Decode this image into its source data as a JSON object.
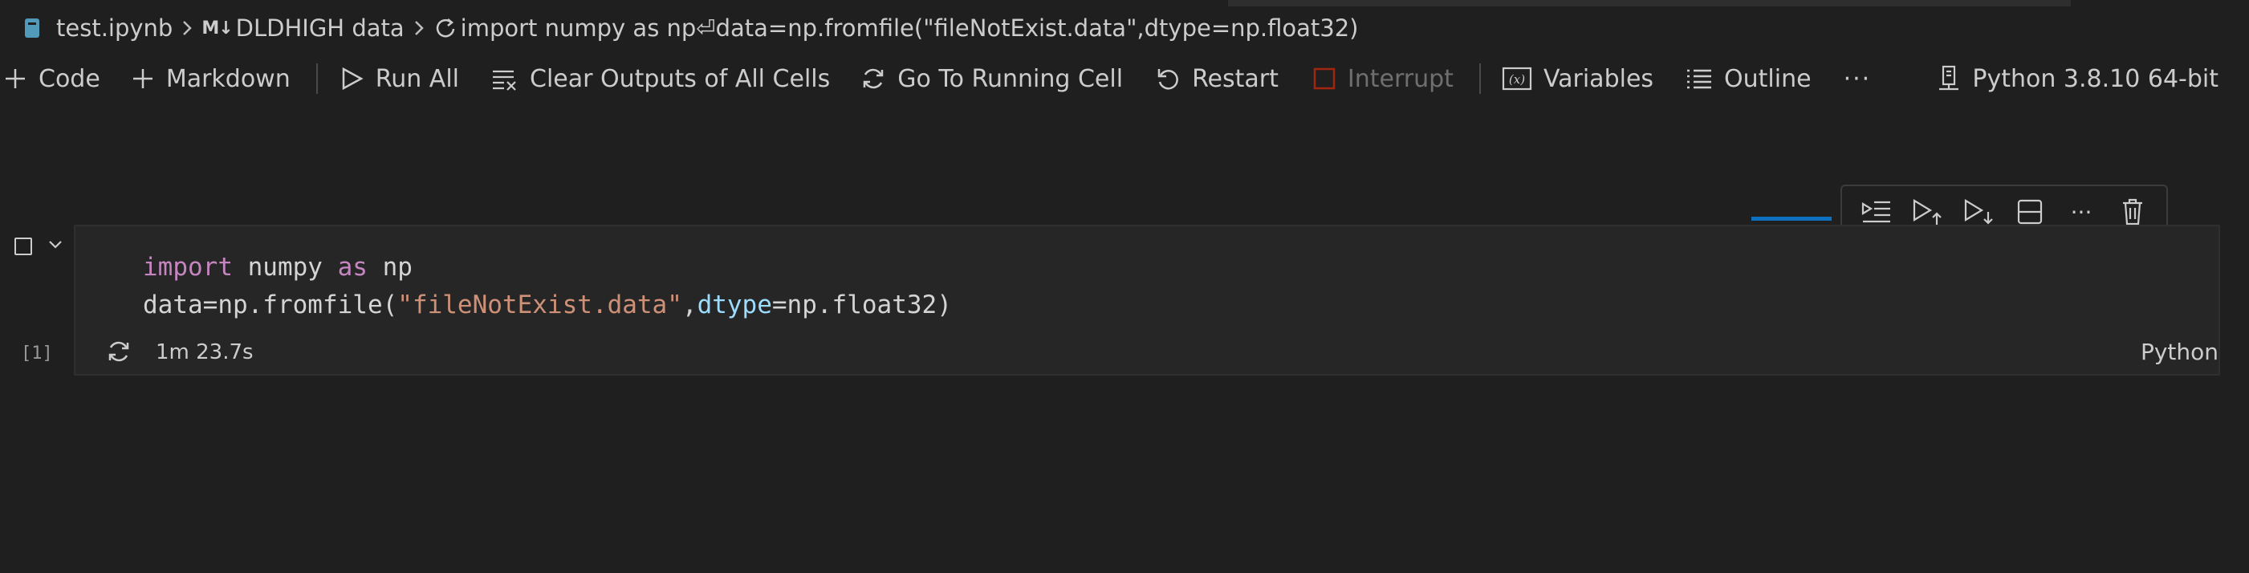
{
  "breadcrumb": {
    "file_name": "test.ipynb",
    "section_marker": "M↓",
    "section_name": "DLDHIGH data",
    "cell_preview": "import numpy as np⏎data=np.fromfile(\"fileNotExist.data\",dtype=np.float32)"
  },
  "toolbar": {
    "code_label": "Code",
    "markdown_label": "Markdown",
    "run_all_label": "Run All",
    "clear_outputs_label": "Clear Outputs of All Cells",
    "go_to_running_label": "Go To Running Cell",
    "restart_label": "Restart",
    "interrupt_label": "Interrupt",
    "variables_label": "Variables",
    "outline_label": "Outline",
    "more_label": "···",
    "kernel_label": "Python 3.8.10 64-bit"
  },
  "cell": {
    "code_line1": {
      "kw1": "import",
      "t1": " numpy ",
      "kw2": "as",
      "t2": " np"
    },
    "code_line2": {
      "t1": "data=np.fromfile(",
      "str": "\"fileNotExist.data\"",
      "t2": ",",
      "param": "dtype",
      "t3": "=np.float32)"
    },
    "execution_count": "[1]",
    "duration": "1m 23.7s",
    "language": "Python",
    "more_label": "···"
  },
  "colors": {
    "background": "#1f1f1f",
    "keyword": "#c586c0",
    "string": "#ce9178",
    "parameter": "#9cdcfe",
    "progress": "#0e70c0"
  }
}
